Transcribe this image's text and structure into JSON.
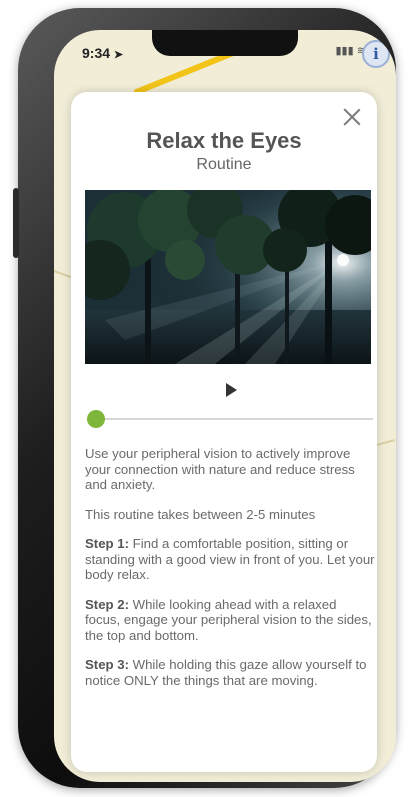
{
  "status": {
    "time": "9:34"
  },
  "modal": {
    "title": "Relax the Eyes",
    "subtitle": "Routine",
    "player": {
      "progress": 0.0
    },
    "intro": "Use your peripheral vision to actively improve your connection with nature and reduce stress and anxiety.",
    "duration": "This routine takes between 2-5 minutes",
    "steps": [
      {
        "label": "Step 1:",
        "text": " Find a comfortable position, sitting or standing with a good view in front of you. Let your body relax."
      },
      {
        "label": "Step 2:",
        "text": " While looking ahead with a relaxed focus, engage your peripheral vision to the sides, the top and bottom."
      },
      {
        "label": "Step 3:",
        "text": " While holding this gaze allow yourself to notice ONLY the things that are moving."
      }
    ]
  },
  "colors": {
    "accent": "#7db63b",
    "title": "#555555",
    "text": "#6a6a6a"
  },
  "icons": {
    "close": "close-icon",
    "play": "play-icon",
    "info": "info-icon"
  }
}
